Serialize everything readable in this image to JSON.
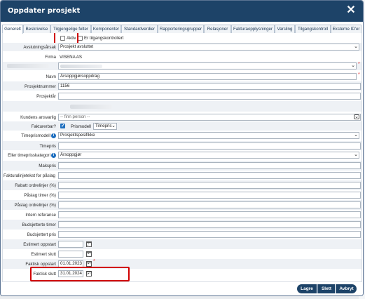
{
  "dialog": {
    "title": "Oppdater prosjekt",
    "close_glyph": "✕"
  },
  "tabs": [
    {
      "label": "Generelt",
      "active": true
    },
    {
      "label": "Beskrivelse"
    },
    {
      "label": "Tilgjengelige felter"
    },
    {
      "label": "Komponenter"
    },
    {
      "label": "Standardverdier"
    },
    {
      "label": "Rapporteringsgrupper"
    },
    {
      "label": "Relasjoner"
    },
    {
      "label": "Fakturaopplysninger"
    },
    {
      "label": "Varsling"
    },
    {
      "label": "Tilgangskontroll"
    },
    {
      "label": "Eksterne ID'er"
    }
  ],
  "flags": {
    "aktiv_label": "Aktiv",
    "aktiv_checked": false,
    "tilgang_label": "Er tilgangskontrollert",
    "tilgang_checked": false
  },
  "form": {
    "avslutningsarsak": {
      "label": "Avslutningsårsak",
      "value": "Prosjekt avsluttet"
    },
    "firma": {
      "label": "Firma",
      "value": "VISENA AS"
    },
    "navn": {
      "label": "Navn",
      "value": "Årsoppgjørsoppdrag"
    },
    "prosjektnummer": {
      "label": "Prosjektnummer",
      "value": "1156"
    },
    "prosjektar": {
      "label": "Prosjektår",
      "value": ""
    },
    "kundens_ansvarlig": {
      "label": "Kundens ansvarlig",
      "value": "-- finn person --"
    },
    "fakturerbar": {
      "label": "Fakturerbar?",
      "checked": true,
      "prismodell_label": "Prismodell",
      "prismodell_value": "Timepris"
    },
    "timeprismodell": {
      "label": "Timeprismodell",
      "value": "Prosjektspesifikke"
    },
    "timepris": {
      "label": "Timepris",
      "value": ""
    },
    "eller_timeprisskategori": {
      "label": "Eller timeprisskategori",
      "value": "Årsoppgjør"
    },
    "makspris": {
      "label": "Makspris",
      "value": ""
    },
    "fakturalinjetekst": {
      "label": "Fakturalinjetekst for påslag",
      "value": ""
    },
    "rabatt": {
      "label": "Rabatt ordrelinjer (%)",
      "value": ""
    },
    "paslag_timer": {
      "label": "Påslag timer (%)",
      "value": ""
    },
    "paslag_ordrelinjer": {
      "label": "Påslag ordrelinjer (%)",
      "value": ""
    },
    "intern_referanse": {
      "label": "Intern referanse",
      "value": ""
    },
    "budsjetterte_timer": {
      "label": "Budsjetterte timer",
      "value": ""
    },
    "budsjettert_pris": {
      "label": "Budsjettert pris",
      "value": ""
    },
    "estimert_oppstart": {
      "label": "Estimert oppstart",
      "value": ""
    },
    "estimert_slutt": {
      "label": "Estimert slutt",
      "value": ""
    },
    "faktisk_oppstart": {
      "label": "Faktisk oppstart",
      "value": "01.01.2023"
    },
    "faktisk_slutt": {
      "label": "Faktisk slutt",
      "value": "31.01.2024"
    }
  },
  "required_mark": "*",
  "buttons": {
    "save": "Lagre",
    "delete": "Slett",
    "cancel": "Avbryt"
  },
  "colors": {
    "titlebar": "#1d4368",
    "button": "#1d4368",
    "highlight": "#d10000",
    "info": "#1f6fbf"
  }
}
